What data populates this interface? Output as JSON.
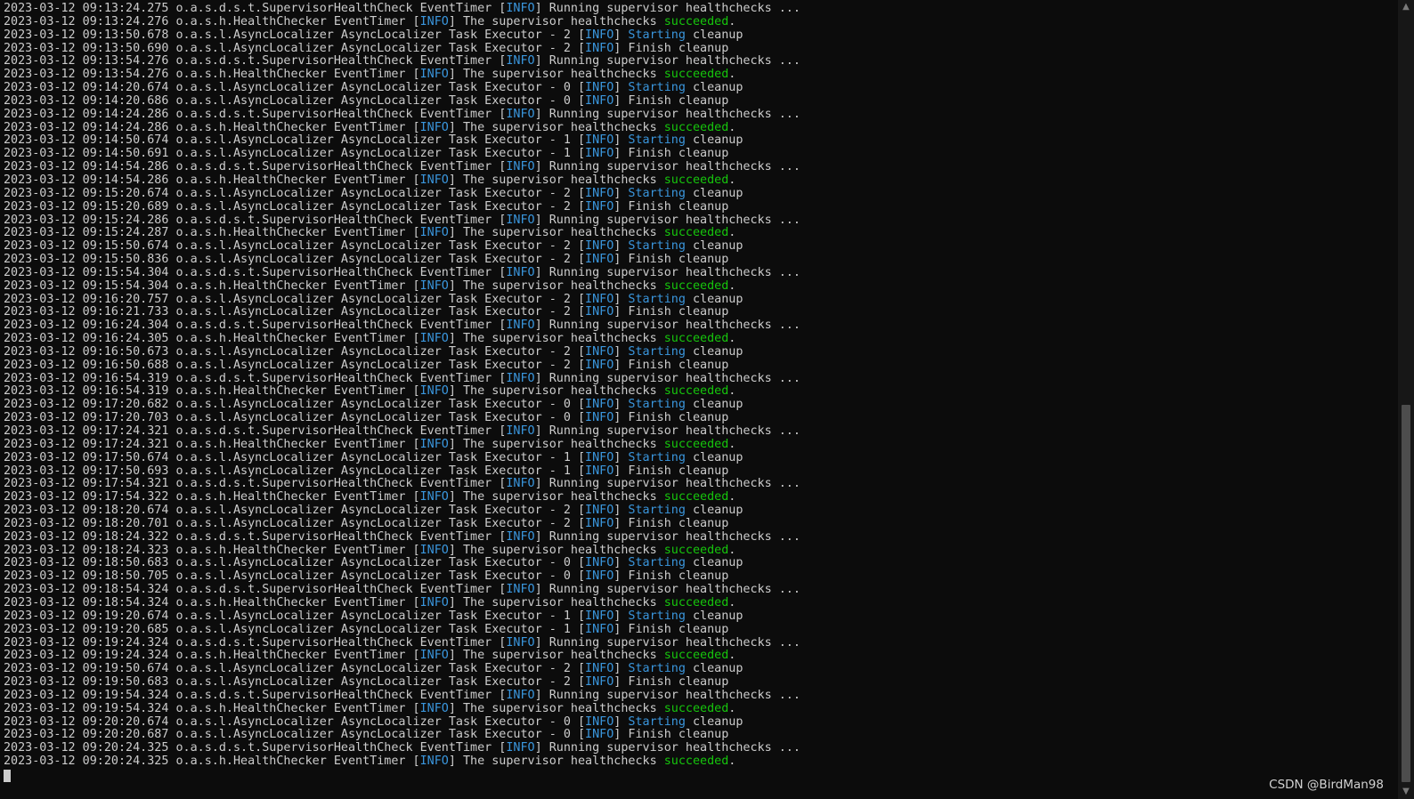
{
  "log_lines": [
    {
      "ts": "2023-03-12 09:13:24.275",
      "src": "o.a.s.d.s.t.SupervisorHealthCheck EventTimer",
      "lvl": "INFO",
      "kw": "",
      "msg": "Running supervisor healthchecks ..."
    },
    {
      "ts": "2023-03-12 09:13:24.276",
      "src": "o.a.s.h.HealthChecker EventTimer",
      "lvl": "INFO",
      "kw": "",
      "msg": "The supervisor healthchecks ",
      "ok": "succeeded",
      "tail": "."
    },
    {
      "ts": "2023-03-12 09:13:50.678",
      "src": "o.a.s.l.AsyncLocalizer AsyncLocalizer Task Executor - 2",
      "lvl": "INFO",
      "kw": "Starting",
      "msg": " cleanup"
    },
    {
      "ts": "2023-03-12 09:13:50.690",
      "src": "o.a.s.l.AsyncLocalizer AsyncLocalizer Task Executor - 2",
      "lvl": "INFO",
      "kw": "",
      "msg": "Finish cleanup"
    },
    {
      "ts": "2023-03-12 09:13:54.276",
      "src": "o.a.s.d.s.t.SupervisorHealthCheck EventTimer",
      "lvl": "INFO",
      "kw": "",
      "msg": "Running supervisor healthchecks ..."
    },
    {
      "ts": "2023-03-12 09:13:54.276",
      "src": "o.a.s.h.HealthChecker EventTimer",
      "lvl": "INFO",
      "kw": "",
      "msg": "The supervisor healthchecks ",
      "ok": "succeeded",
      "tail": "."
    },
    {
      "ts": "2023-03-12 09:14:20.674",
      "src": "o.a.s.l.AsyncLocalizer AsyncLocalizer Task Executor - 0",
      "lvl": "INFO",
      "kw": "Starting",
      "msg": " cleanup"
    },
    {
      "ts": "2023-03-12 09:14:20.686",
      "src": "o.a.s.l.AsyncLocalizer AsyncLocalizer Task Executor - 0",
      "lvl": "INFO",
      "kw": "",
      "msg": "Finish cleanup"
    },
    {
      "ts": "2023-03-12 09:14:24.286",
      "src": "o.a.s.d.s.t.SupervisorHealthCheck EventTimer",
      "lvl": "INFO",
      "kw": "",
      "msg": "Running supervisor healthchecks ..."
    },
    {
      "ts": "2023-03-12 09:14:24.286",
      "src": "o.a.s.h.HealthChecker EventTimer",
      "lvl": "INFO",
      "kw": "",
      "msg": "The supervisor healthchecks ",
      "ok": "succeeded",
      "tail": "."
    },
    {
      "ts": "2023-03-12 09:14:50.674",
      "src": "o.a.s.l.AsyncLocalizer AsyncLocalizer Task Executor - 1",
      "lvl": "INFO",
      "kw": "Starting",
      "msg": " cleanup"
    },
    {
      "ts": "2023-03-12 09:14:50.691",
      "src": "o.a.s.l.AsyncLocalizer AsyncLocalizer Task Executor - 1",
      "lvl": "INFO",
      "kw": "",
      "msg": "Finish cleanup"
    },
    {
      "ts": "2023-03-12 09:14:54.286",
      "src": "o.a.s.d.s.t.SupervisorHealthCheck EventTimer",
      "lvl": "INFO",
      "kw": "",
      "msg": "Running supervisor healthchecks ..."
    },
    {
      "ts": "2023-03-12 09:14:54.286",
      "src": "o.a.s.h.HealthChecker EventTimer",
      "lvl": "INFO",
      "kw": "",
      "msg": "The supervisor healthchecks ",
      "ok": "succeeded",
      "tail": "."
    },
    {
      "ts": "2023-03-12 09:15:20.674",
      "src": "o.a.s.l.AsyncLocalizer AsyncLocalizer Task Executor - 2",
      "lvl": "INFO",
      "kw": "Starting",
      "msg": " cleanup"
    },
    {
      "ts": "2023-03-12 09:15:20.689",
      "src": "o.a.s.l.AsyncLocalizer AsyncLocalizer Task Executor - 2",
      "lvl": "INFO",
      "kw": "",
      "msg": "Finish cleanup"
    },
    {
      "ts": "2023-03-12 09:15:24.286",
      "src": "o.a.s.d.s.t.SupervisorHealthCheck EventTimer",
      "lvl": "INFO",
      "kw": "",
      "msg": "Running supervisor healthchecks ..."
    },
    {
      "ts": "2023-03-12 09:15:24.287",
      "src": "o.a.s.h.HealthChecker EventTimer",
      "lvl": "INFO",
      "kw": "",
      "msg": "The supervisor healthchecks ",
      "ok": "succeeded",
      "tail": "."
    },
    {
      "ts": "2023-03-12 09:15:50.674",
      "src": "o.a.s.l.AsyncLocalizer AsyncLocalizer Task Executor - 2",
      "lvl": "INFO",
      "kw": "Starting",
      "msg": " cleanup"
    },
    {
      "ts": "2023-03-12 09:15:50.836",
      "src": "o.a.s.l.AsyncLocalizer AsyncLocalizer Task Executor - 2",
      "lvl": "INFO",
      "kw": "",
      "msg": "Finish cleanup"
    },
    {
      "ts": "2023-03-12 09:15:54.304",
      "src": "o.a.s.d.s.t.SupervisorHealthCheck EventTimer",
      "lvl": "INFO",
      "kw": "",
      "msg": "Running supervisor healthchecks ..."
    },
    {
      "ts": "2023-03-12 09:15:54.304",
      "src": "o.a.s.h.HealthChecker EventTimer",
      "lvl": "INFO",
      "kw": "",
      "msg": "The supervisor healthchecks ",
      "ok": "succeeded",
      "tail": "."
    },
    {
      "ts": "2023-03-12 09:16:20.757",
      "src": "o.a.s.l.AsyncLocalizer AsyncLocalizer Task Executor - 2",
      "lvl": "INFO",
      "kw": "Starting",
      "msg": " cleanup"
    },
    {
      "ts": "2023-03-12 09:16:21.733",
      "src": "o.a.s.l.AsyncLocalizer AsyncLocalizer Task Executor - 2",
      "lvl": "INFO",
      "kw": "",
      "msg": "Finish cleanup"
    },
    {
      "ts": "2023-03-12 09:16:24.304",
      "src": "o.a.s.d.s.t.SupervisorHealthCheck EventTimer",
      "lvl": "INFO",
      "kw": "",
      "msg": "Running supervisor healthchecks ..."
    },
    {
      "ts": "2023-03-12 09:16:24.305",
      "src": "o.a.s.h.HealthChecker EventTimer",
      "lvl": "INFO",
      "kw": "",
      "msg": "The supervisor healthchecks ",
      "ok": "succeeded",
      "tail": "."
    },
    {
      "ts": "2023-03-12 09:16:50.673",
      "src": "o.a.s.l.AsyncLocalizer AsyncLocalizer Task Executor - 2",
      "lvl": "INFO",
      "kw": "Starting",
      "msg": " cleanup"
    },
    {
      "ts": "2023-03-12 09:16:50.688",
      "src": "o.a.s.l.AsyncLocalizer AsyncLocalizer Task Executor - 2",
      "lvl": "INFO",
      "kw": "",
      "msg": "Finish cleanup"
    },
    {
      "ts": "2023-03-12 09:16:54.319",
      "src": "o.a.s.d.s.t.SupervisorHealthCheck EventTimer",
      "lvl": "INFO",
      "kw": "",
      "msg": "Running supervisor healthchecks ..."
    },
    {
      "ts": "2023-03-12 09:16:54.319",
      "src": "o.a.s.h.HealthChecker EventTimer",
      "lvl": "INFO",
      "kw": "",
      "msg": "The supervisor healthchecks ",
      "ok": "succeeded",
      "tail": "."
    },
    {
      "ts": "2023-03-12 09:17:20.682",
      "src": "o.a.s.l.AsyncLocalizer AsyncLocalizer Task Executor - 0",
      "lvl": "INFO",
      "kw": "Starting",
      "msg": " cleanup"
    },
    {
      "ts": "2023-03-12 09:17:20.703",
      "src": "o.a.s.l.AsyncLocalizer AsyncLocalizer Task Executor - 0",
      "lvl": "INFO",
      "kw": "",
      "msg": "Finish cleanup"
    },
    {
      "ts": "2023-03-12 09:17:24.321",
      "src": "o.a.s.d.s.t.SupervisorHealthCheck EventTimer",
      "lvl": "INFO",
      "kw": "",
      "msg": "Running supervisor healthchecks ..."
    },
    {
      "ts": "2023-03-12 09:17:24.321",
      "src": "o.a.s.h.HealthChecker EventTimer",
      "lvl": "INFO",
      "kw": "",
      "msg": "The supervisor healthchecks ",
      "ok": "succeeded",
      "tail": "."
    },
    {
      "ts": "2023-03-12 09:17:50.674",
      "src": "o.a.s.l.AsyncLocalizer AsyncLocalizer Task Executor - 1",
      "lvl": "INFO",
      "kw": "Starting",
      "msg": " cleanup"
    },
    {
      "ts": "2023-03-12 09:17:50.693",
      "src": "o.a.s.l.AsyncLocalizer AsyncLocalizer Task Executor - 1",
      "lvl": "INFO",
      "kw": "",
      "msg": "Finish cleanup"
    },
    {
      "ts": "2023-03-12 09:17:54.321",
      "src": "o.a.s.d.s.t.SupervisorHealthCheck EventTimer",
      "lvl": "INFO",
      "kw": "",
      "msg": "Running supervisor healthchecks ..."
    },
    {
      "ts": "2023-03-12 09:17:54.322",
      "src": "o.a.s.h.HealthChecker EventTimer",
      "lvl": "INFO",
      "kw": "",
      "msg": "The supervisor healthchecks ",
      "ok": "succeeded",
      "tail": "."
    },
    {
      "ts": "2023-03-12 09:18:20.674",
      "src": "o.a.s.l.AsyncLocalizer AsyncLocalizer Task Executor - 2",
      "lvl": "INFO",
      "kw": "Starting",
      "msg": " cleanup"
    },
    {
      "ts": "2023-03-12 09:18:20.701",
      "src": "o.a.s.l.AsyncLocalizer AsyncLocalizer Task Executor - 2",
      "lvl": "INFO",
      "kw": "",
      "msg": "Finish cleanup"
    },
    {
      "ts": "2023-03-12 09:18:24.322",
      "src": "o.a.s.d.s.t.SupervisorHealthCheck EventTimer",
      "lvl": "INFO",
      "kw": "",
      "msg": "Running supervisor healthchecks ..."
    },
    {
      "ts": "2023-03-12 09:18:24.323",
      "src": "o.a.s.h.HealthChecker EventTimer",
      "lvl": "INFO",
      "kw": "",
      "msg": "The supervisor healthchecks ",
      "ok": "succeeded",
      "tail": "."
    },
    {
      "ts": "2023-03-12 09:18:50.683",
      "src": "o.a.s.l.AsyncLocalizer AsyncLocalizer Task Executor - 0",
      "lvl": "INFO",
      "kw": "Starting",
      "msg": " cleanup"
    },
    {
      "ts": "2023-03-12 09:18:50.705",
      "src": "o.a.s.l.AsyncLocalizer AsyncLocalizer Task Executor - 0",
      "lvl": "INFO",
      "kw": "",
      "msg": "Finish cleanup"
    },
    {
      "ts": "2023-03-12 09:18:54.324",
      "src": "o.a.s.d.s.t.SupervisorHealthCheck EventTimer",
      "lvl": "INFO",
      "kw": "",
      "msg": "Running supervisor healthchecks ..."
    },
    {
      "ts": "2023-03-12 09:18:54.324",
      "src": "o.a.s.h.HealthChecker EventTimer",
      "lvl": "INFO",
      "kw": "",
      "msg": "The supervisor healthchecks ",
      "ok": "succeeded",
      "tail": "."
    },
    {
      "ts": "2023-03-12 09:19:20.674",
      "src": "o.a.s.l.AsyncLocalizer AsyncLocalizer Task Executor - 1",
      "lvl": "INFO",
      "kw": "Starting",
      "msg": " cleanup"
    },
    {
      "ts": "2023-03-12 09:19:20.685",
      "src": "o.a.s.l.AsyncLocalizer AsyncLocalizer Task Executor - 1",
      "lvl": "INFO",
      "kw": "",
      "msg": "Finish cleanup"
    },
    {
      "ts": "2023-03-12 09:19:24.324",
      "src": "o.a.s.d.s.t.SupervisorHealthCheck EventTimer",
      "lvl": "INFO",
      "kw": "",
      "msg": "Running supervisor healthchecks ..."
    },
    {
      "ts": "2023-03-12 09:19:24.324",
      "src": "o.a.s.h.HealthChecker EventTimer",
      "lvl": "INFO",
      "kw": "",
      "msg": "The supervisor healthchecks ",
      "ok": "succeeded",
      "tail": "."
    },
    {
      "ts": "2023-03-12 09:19:50.674",
      "src": "o.a.s.l.AsyncLocalizer AsyncLocalizer Task Executor - 2",
      "lvl": "INFO",
      "kw": "Starting",
      "msg": " cleanup"
    },
    {
      "ts": "2023-03-12 09:19:50.683",
      "src": "o.a.s.l.AsyncLocalizer AsyncLocalizer Task Executor - 2",
      "lvl": "INFO",
      "kw": "",
      "msg": "Finish cleanup"
    },
    {
      "ts": "2023-03-12 09:19:54.324",
      "src": "o.a.s.d.s.t.SupervisorHealthCheck EventTimer",
      "lvl": "INFO",
      "kw": "",
      "msg": "Running supervisor healthchecks ..."
    },
    {
      "ts": "2023-03-12 09:19:54.324",
      "src": "o.a.s.h.HealthChecker EventTimer",
      "lvl": "INFO",
      "kw": "",
      "msg": "The supervisor healthchecks ",
      "ok": "succeeded",
      "tail": "."
    },
    {
      "ts": "2023-03-12 09:20:20.674",
      "src": "o.a.s.l.AsyncLocalizer AsyncLocalizer Task Executor - 0",
      "lvl": "INFO",
      "kw": "Starting",
      "msg": " cleanup"
    },
    {
      "ts": "2023-03-12 09:20:20.687",
      "src": "o.a.s.l.AsyncLocalizer AsyncLocalizer Task Executor - 0",
      "lvl": "INFO",
      "kw": "",
      "msg": "Finish cleanup"
    },
    {
      "ts": "2023-03-12 09:20:24.325",
      "src": "o.a.s.d.s.t.SupervisorHealthCheck EventTimer",
      "lvl": "INFO",
      "kw": "",
      "msg": "Running supervisor healthchecks ..."
    },
    {
      "ts": "2023-03-12 09:20:24.325",
      "src": "o.a.s.h.HealthChecker EventTimer",
      "lvl": "INFO",
      "kw": "",
      "msg": "The supervisor healthchecks ",
      "ok": "succeeded",
      "tail": "."
    }
  ],
  "scrollbar": {
    "up_icon": "▲",
    "down_icon": "▼"
  },
  "watermark": "CSDN @BirdMan98",
  "colors": {
    "background": "#0c0c0c",
    "text": "#cccccc",
    "info": "#3a96dd",
    "success": "#16c60c"
  }
}
